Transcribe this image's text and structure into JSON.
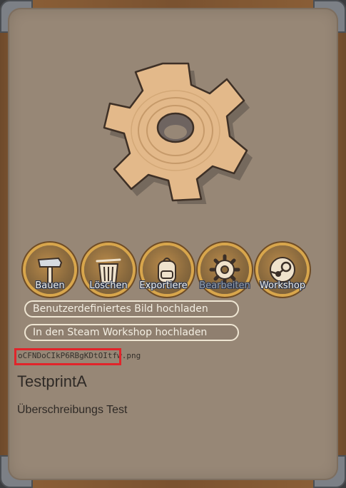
{
  "buttons": [
    {
      "label": "Bauen",
      "icon": "hammer-icon"
    },
    {
      "label": "Löschen",
      "icon": "trash-icon"
    },
    {
      "label": "Exportiere",
      "icon": "backpack-icon"
    },
    {
      "label": "Bearbeiten",
      "icon": "gear-icon",
      "disabled": true
    },
    {
      "label": "Workshop",
      "icon": "steam-icon"
    }
  ],
  "actions": {
    "upload_image": "Benutzerdefiniertes Bild hochladen",
    "upload_workshop": "In den Steam Workshop hochladen"
  },
  "file": {
    "name": "oCFNDoCIkP6RBgKDtOItfw.png"
  },
  "blueprint": {
    "title": "TestprintA",
    "description": "Überschreibungs Test"
  },
  "colors": {
    "card": "#978776",
    "button_ring": "#d8a64c",
    "label_outline": "#253350",
    "highlight_box": "#e1242a"
  }
}
